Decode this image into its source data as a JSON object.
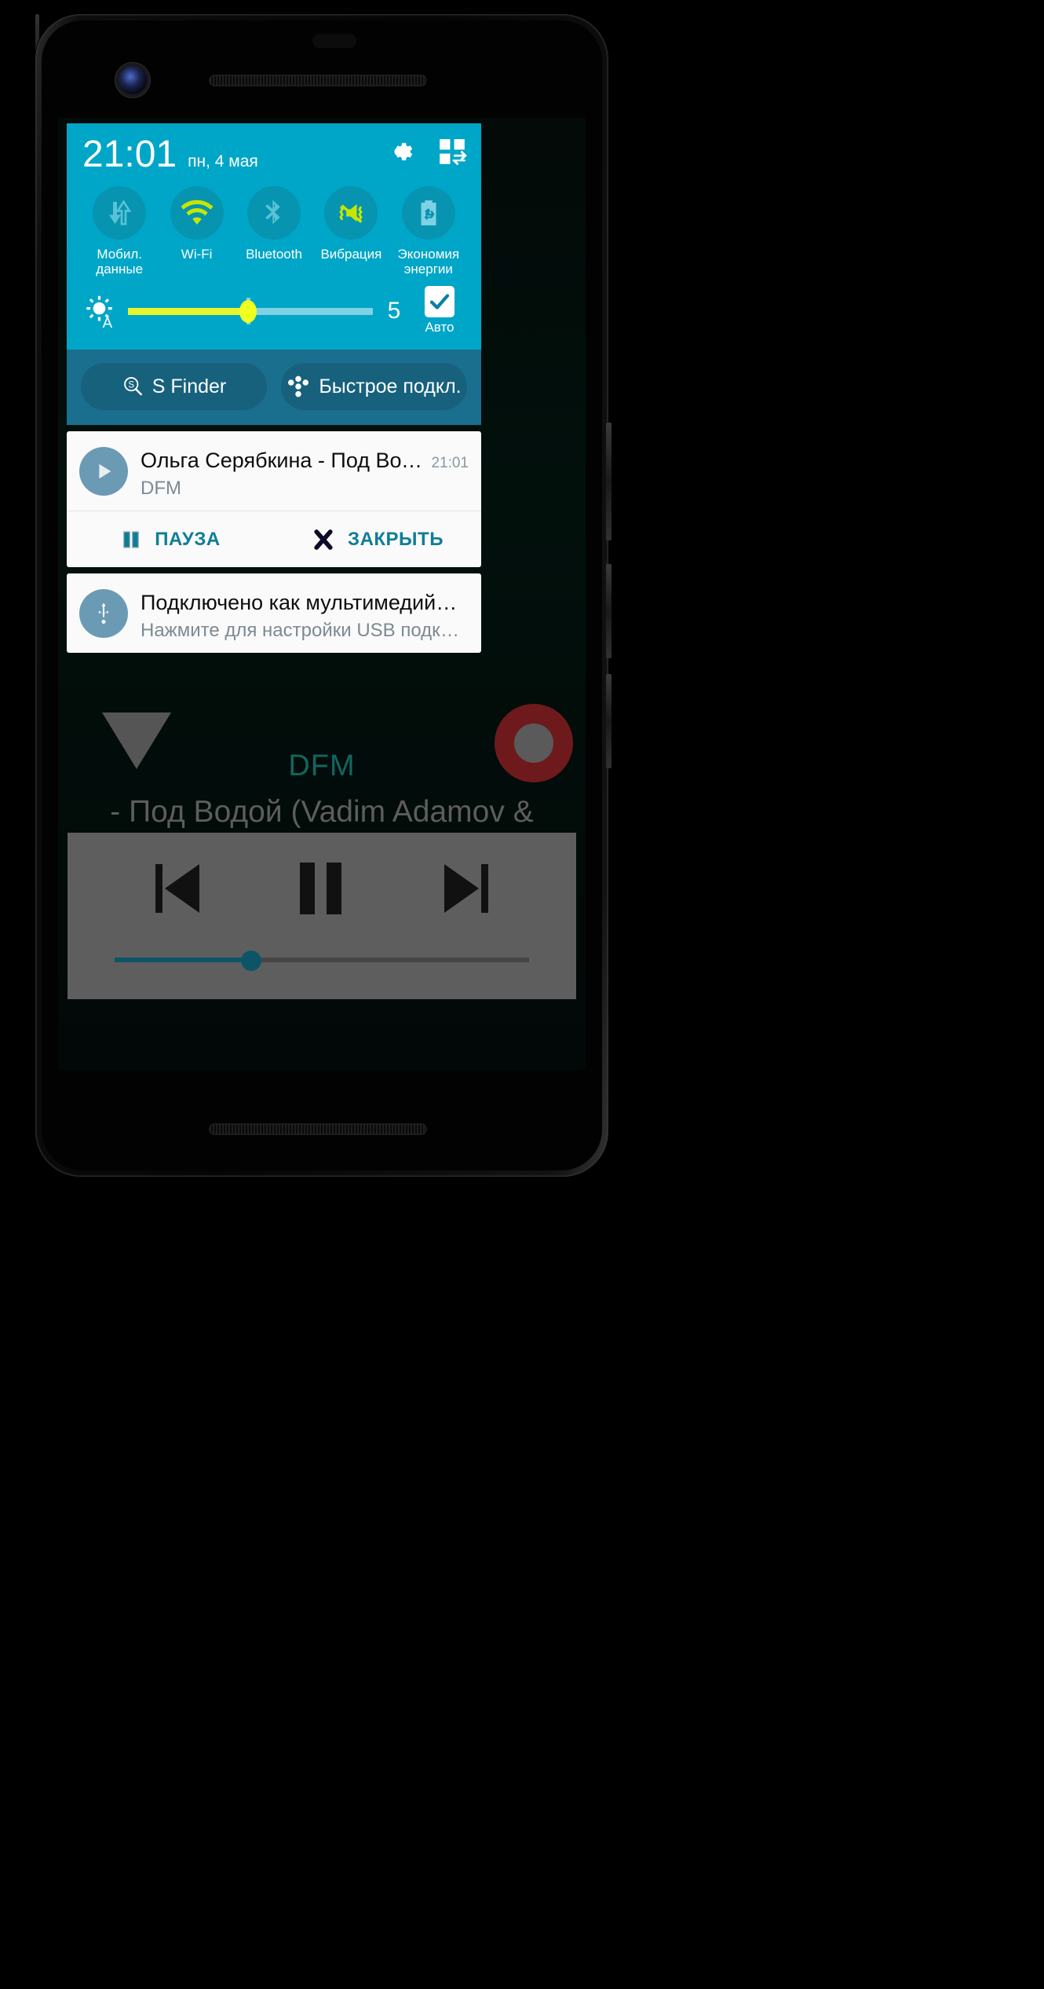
{
  "statusbar": {
    "time": "21:01",
    "date": "пн, 4 мая",
    "gear_icon": "gear-icon",
    "edit_icon": "quick-settings-edit-icon"
  },
  "quick_toggles": [
    {
      "label": "Мобил.\nданные",
      "icon": "mobile-data-icon",
      "active": false
    },
    {
      "label": "Wi-Fi",
      "icon": "wifi-icon",
      "active": true
    },
    {
      "label": "Bluetooth",
      "icon": "bluetooth-icon",
      "active": false
    },
    {
      "label": "Вибрация",
      "icon": "vibration-icon",
      "active": true
    },
    {
      "label": "Экономия\nэнергии",
      "icon": "power-saving-icon",
      "active": false
    }
  ],
  "brightness": {
    "icon": "brightness-auto-icon",
    "value": "5",
    "percent": 49,
    "auto_label": "Авто",
    "auto_checked": true
  },
  "finder_bar": {
    "s_finder_label": "S Finder",
    "s_finder_icon": "s-finder-icon",
    "quick_connect_label": "Быстрое подкл.",
    "quick_connect_icon": "quick-connect-icon"
  },
  "notifications": [
    {
      "id": "music",
      "avatar_icon": "play-icon",
      "title": "Ольга Серябкина - Под Водо…",
      "time": "21:01",
      "subtitle": "DFM",
      "actions": [
        {
          "label": "ПАУЗА",
          "icon": "pause-icon"
        },
        {
          "label": "ЗАКРЫТЬ",
          "icon": "close-icon"
        }
      ]
    },
    {
      "id": "usb",
      "avatar_icon": "usb-icon",
      "title": "Подключено как мультимедийно…",
      "time": "",
      "subtitle": "Нажмите для настройки USB подключе…",
      "actions": []
    }
  ],
  "background_app": {
    "station": "DFM",
    "track": "- Под Водой (Vadim Adamov & ",
    "record_icon": "record-button-icon",
    "caret_icon": "dropdown-caret-icon",
    "controls": {
      "prev": "previous-track-icon",
      "pause": "pause-icon",
      "next": "next-track-icon"
    },
    "seek_percent": 33
  },
  "colors": {
    "accent_teal": "#00a6c7",
    "finder_band": "#1a6e8e",
    "toggle_active": "#c6e600",
    "toggle_inactive": "#59c2d6",
    "slider_yellow": "#e9f529",
    "action_teal": "#0f7d97"
  }
}
